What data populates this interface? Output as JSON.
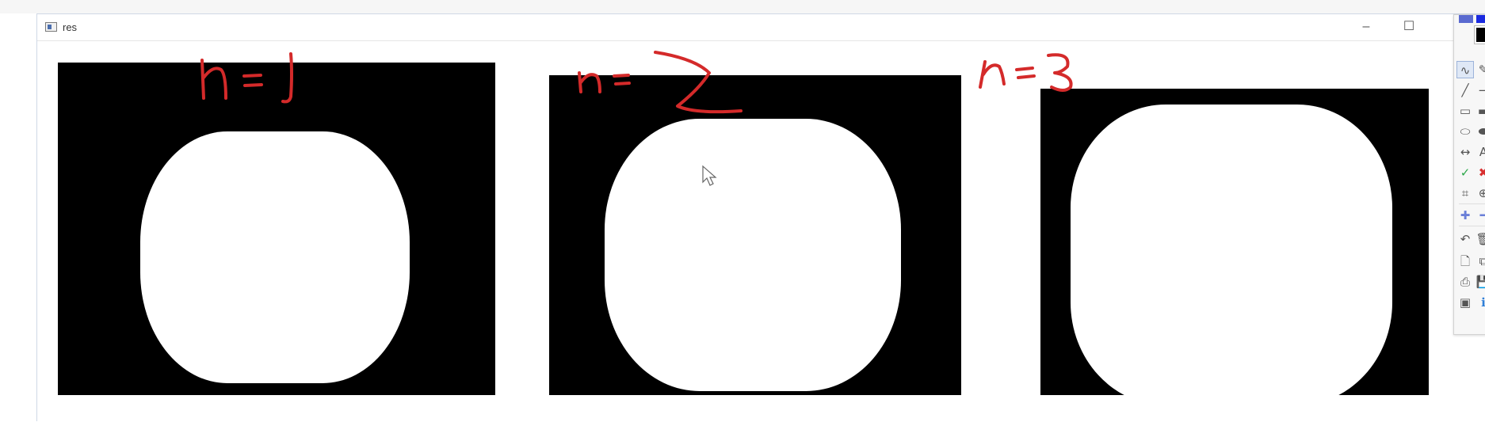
{
  "window": {
    "title": "res",
    "minimize_glyph": "–",
    "maximize_glyph": "☐"
  },
  "panels": [
    {
      "id": "n1",
      "annotation": "n = 1"
    },
    {
      "id": "n2",
      "annotation": "n = 2"
    },
    {
      "id": "n3",
      "annotation": "n = 3"
    }
  ],
  "annotation_color": "#d42a2a",
  "toolbar": {
    "tools": [
      {
        "name": "freehand-tool",
        "glyph": "∿",
        "active": true
      },
      {
        "name": "eraser-tool",
        "glyph": "✎"
      },
      {
        "name": "line-tool",
        "glyph": "╱"
      },
      {
        "name": "arrow-tool",
        "glyph": "→"
      },
      {
        "name": "rectangle-tool",
        "glyph": "▭"
      },
      {
        "name": "filled-rectangle-tool",
        "glyph": "▬"
      },
      {
        "name": "ellipse-tool",
        "glyph": "⬭"
      },
      {
        "name": "filled-ellipse-tool",
        "glyph": "⬬"
      },
      {
        "name": "double-arrow-tool",
        "glyph": "↔"
      },
      {
        "name": "text-tool",
        "glyph": "A"
      },
      {
        "name": "check-tool",
        "glyph": "✓"
      },
      {
        "name": "cross-tool",
        "glyph": "✖"
      },
      {
        "name": "crop-tool",
        "glyph": "⌗"
      },
      {
        "name": "zoom-tool",
        "glyph": "⊕"
      },
      {
        "name": "increase-size-tool",
        "glyph": "✚"
      },
      {
        "name": "decrease-size-tool",
        "glyph": "━"
      },
      {
        "name": "undo-tool",
        "glyph": "↶"
      },
      {
        "name": "delete-tool",
        "glyph": "🗑"
      },
      {
        "name": "new-page-tool",
        "glyph": "🗋"
      },
      {
        "name": "copy-tool",
        "glyph": "⧉"
      },
      {
        "name": "print-tool",
        "glyph": "⎙"
      },
      {
        "name": "save-tool",
        "glyph": "💾"
      },
      {
        "name": "screen-tool",
        "glyph": "▣"
      },
      {
        "name": "info-tool",
        "glyph": "ℹ"
      }
    ],
    "colors": {
      "top_swatch_1": "#5a6ad0",
      "top_swatch_2": "#1a2ae0",
      "fill_swatch": "#000000"
    }
  }
}
